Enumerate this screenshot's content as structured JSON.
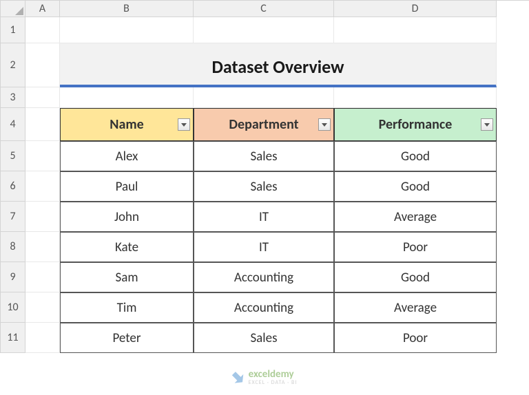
{
  "columns": [
    "A",
    "B",
    "C",
    "D"
  ],
  "rows": [
    "1",
    "2",
    "3",
    "4",
    "5",
    "6",
    "7",
    "8",
    "9",
    "10",
    "11"
  ],
  "title": "Dataset Overview",
  "headers": {
    "name": "Name",
    "department": "Department",
    "performance": "Performance"
  },
  "chart_data": {
    "type": "table",
    "title": "Dataset Overview",
    "columns": [
      "Name",
      "Department",
      "Performance"
    ],
    "rows": [
      {
        "name": "Alex",
        "department": "Sales",
        "performance": "Good"
      },
      {
        "name": "Paul",
        "department": "Sales",
        "performance": "Good"
      },
      {
        "name": "John",
        "department": "IT",
        "performance": "Average"
      },
      {
        "name": "Kate",
        "department": "IT",
        "performance": "Poor"
      },
      {
        "name": "Sam",
        "department": "Accounting",
        "performance": "Good"
      },
      {
        "name": "Tim",
        "department": "Accounting",
        "performance": "Average"
      },
      {
        "name": "Peter",
        "department": "Sales",
        "performance": "Poor"
      }
    ]
  },
  "watermark": {
    "main": "exceldemy",
    "sub": "EXCEL · DATA · BI"
  }
}
